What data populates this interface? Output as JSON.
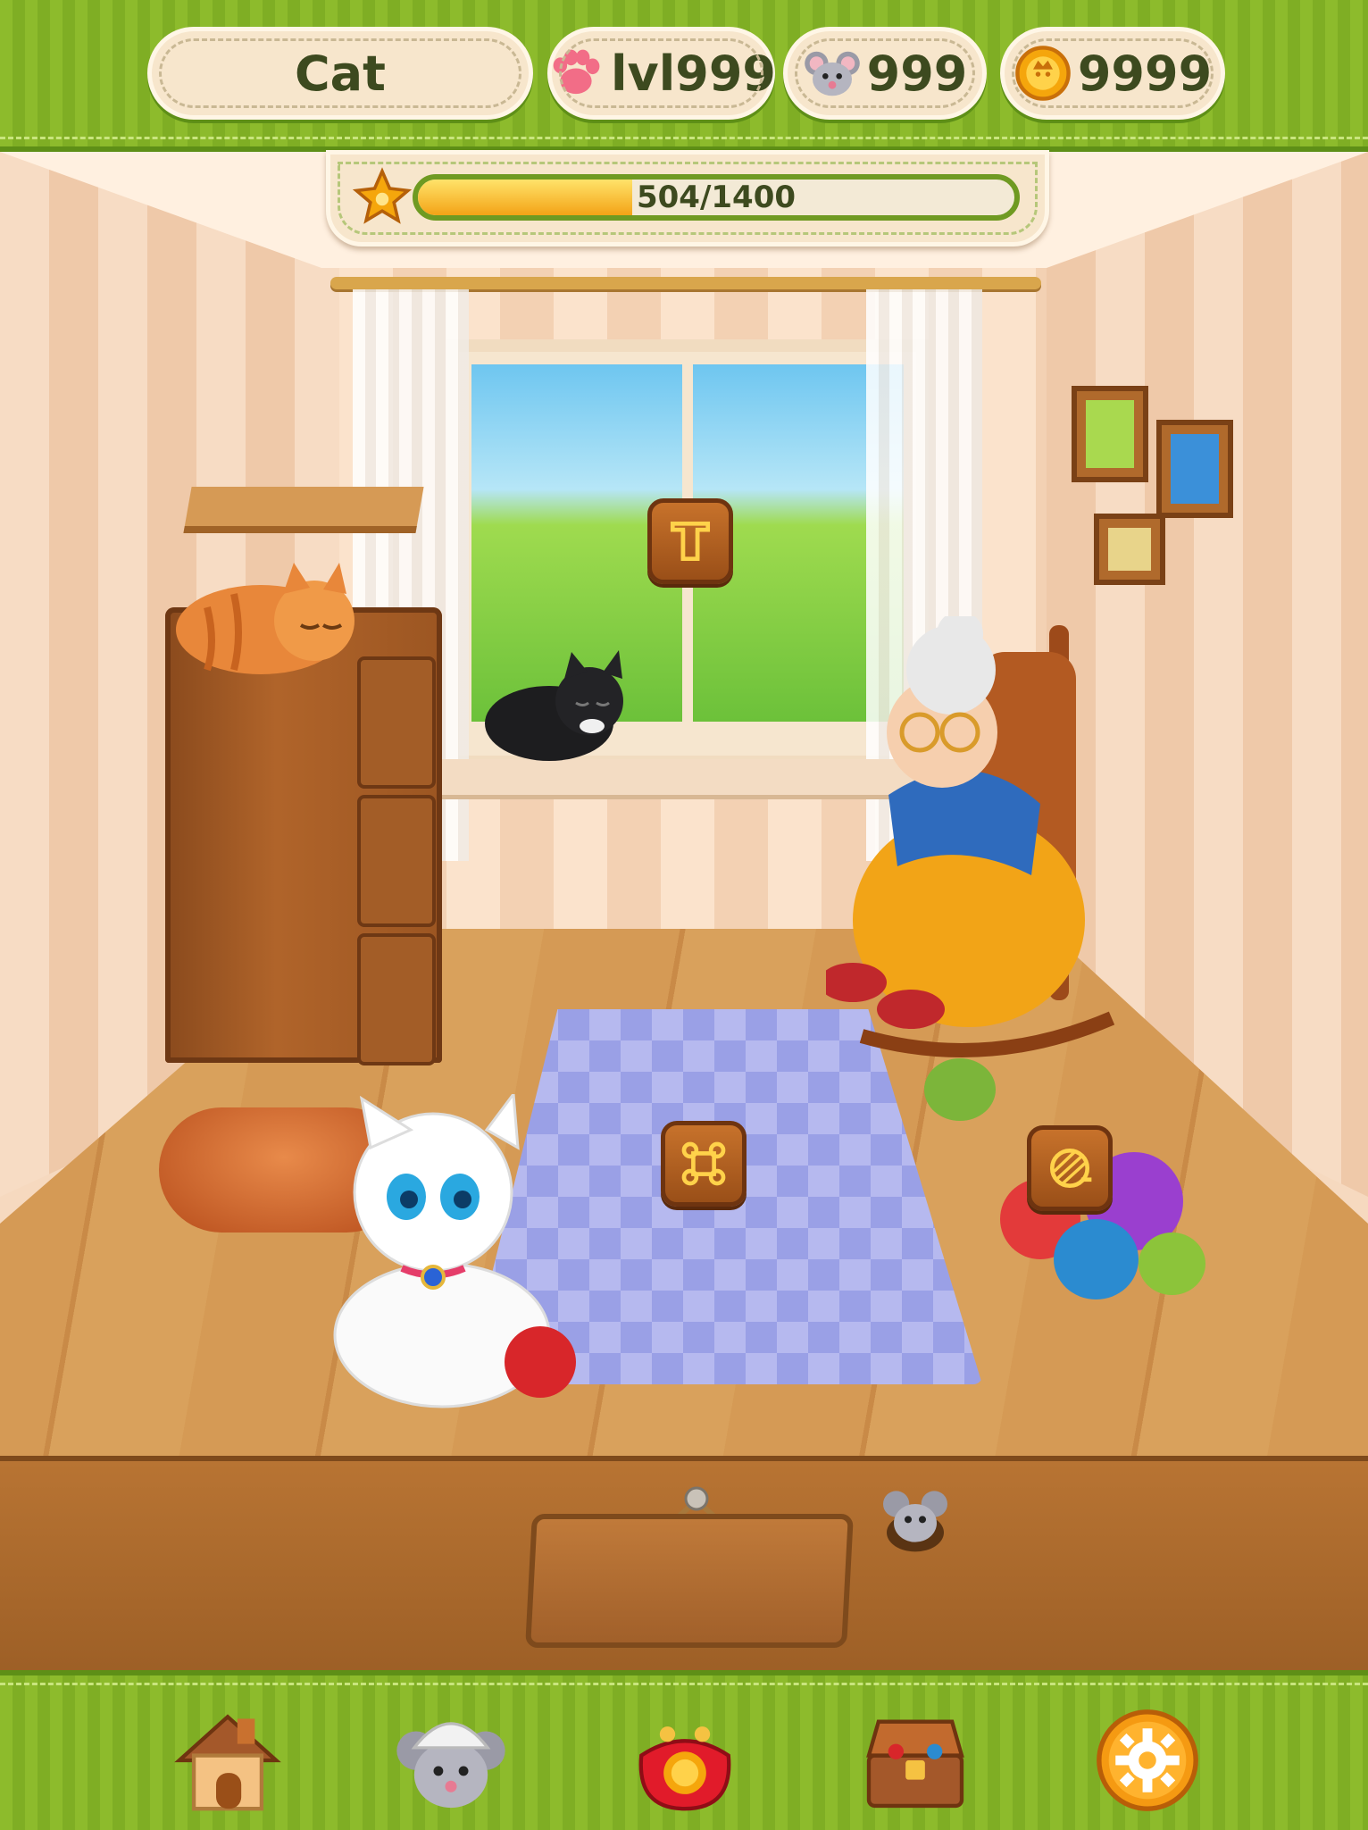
{
  "header": {
    "player_name": "Cat",
    "level": "lvl999",
    "mice": "999",
    "coins": "9999",
    "icons": {
      "level": "paw-icon",
      "mice": "mouse-icon",
      "coins": "coin-icon"
    }
  },
  "xp": {
    "current": 504,
    "max": 1400,
    "label": "504/1400",
    "icon": "star-icon"
  },
  "hotspots": [
    {
      "name": "window-hotspot",
      "icon": "window-rune-icon"
    },
    {
      "name": "rug-hotspot",
      "icon": "rug-rune-icon"
    },
    {
      "name": "yarn-hotspot",
      "icon": "yarn-rune-icon"
    }
  ],
  "nav": [
    {
      "name": "home",
      "icon": "house-icon"
    },
    {
      "name": "mouse-helper",
      "icon": "mouse-helmet-icon"
    },
    {
      "name": "wallet",
      "icon": "purse-icon"
    },
    {
      "name": "chest",
      "icon": "treasure-chest-icon"
    },
    {
      "name": "settings",
      "icon": "gear-icon"
    }
  ],
  "colors": {
    "grass": "#8dbb2c",
    "accent": "#f3a316",
    "wood": "#b87433"
  }
}
